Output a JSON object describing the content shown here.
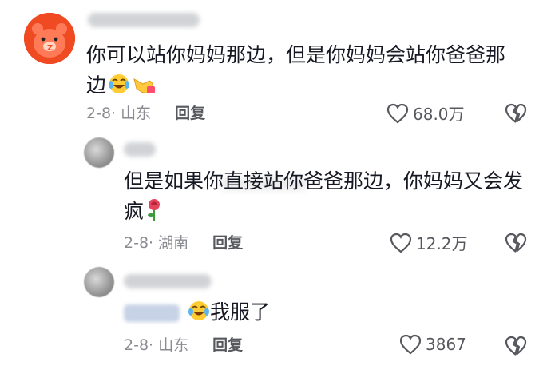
{
  "comments": [
    {
      "text": "你可以站你妈妈那边，但是你妈妈会站你爸爸那边",
      "emojis": [
        "laugh-cry-emoji",
        "pointing-hand-emoji"
      ],
      "date": "2-8",
      "location": "· 山东",
      "reply_label": "回复",
      "likes": "68.0万"
    },
    {
      "text": "但是如果你直接站你爸爸那边，你妈妈又会发疯",
      "emojis": [
        "rose-emoji"
      ],
      "date": "2-8",
      "location": "· 湖南",
      "reply_label": "回复",
      "likes": "12.2万"
    },
    {
      "text": "我服了",
      "emojis": [
        "laugh-cry-emoji"
      ],
      "date": "2-8",
      "location": "· 山东",
      "reply_label": "回复",
      "likes": "3867"
    }
  ],
  "colors": {
    "primary_text": "#161823",
    "secondary_text": "#8a8b91",
    "reply_text": "#57585e",
    "avatar_bg": "#f04a23"
  }
}
